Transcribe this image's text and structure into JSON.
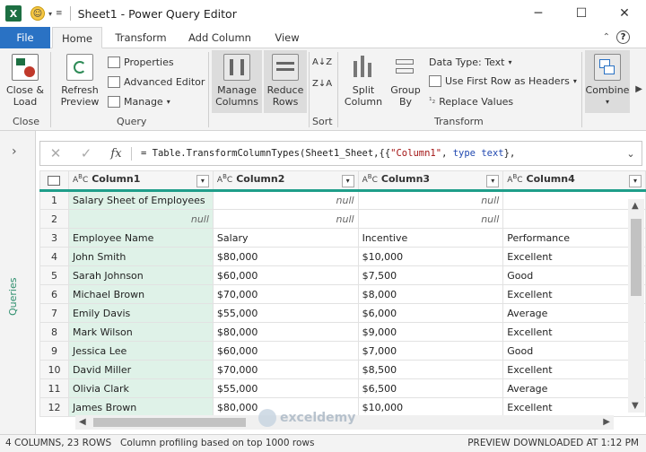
{
  "titlebar": {
    "logo": "X",
    "title": "Sheet1 - Power Query Editor",
    "minimize": "─",
    "maximize": "☐",
    "close": "✕"
  },
  "tabs": {
    "file": "File",
    "home": "Home",
    "transform": "Transform",
    "add_column": "Add Column",
    "view": "View",
    "help": "?"
  },
  "ribbon": {
    "close_load": "Close &\nLoad",
    "close_group": "Close",
    "refresh_preview": "Refresh\nPreview",
    "properties": "Properties",
    "advanced_editor": "Advanced Editor",
    "manage": "Manage",
    "query_group": "Query",
    "manage_columns": "Manage\nColumns",
    "reduce_rows": "Reduce\nRows",
    "sort_group": "Sort",
    "split_column": "Split\nColumn",
    "group_by": "Group\nBy",
    "data_type": "Data Type: Text",
    "use_first_row": "Use First Row as Headers",
    "replace_values": "Replace Values",
    "transform_group": "Transform",
    "combine": "Combine"
  },
  "sidebar": {
    "label": "Queries"
  },
  "formula": {
    "cancel": "✕",
    "commit": "✓",
    "fx": "fx",
    "prefix": "= Table.TransformColumnTypes(Sheet1_Sheet,{{",
    "string": "\"Column1\"",
    "sep": ", ",
    "keyword": "type text",
    "suffix": "},"
  },
  "table": {
    "columns": [
      "Column1",
      "Column2",
      "Column3",
      "Column4"
    ],
    "rows": [
      {
        "n": "1",
        "c": [
          "Salary Sheet of Employees",
          "null",
          "null",
          ""
        ]
      },
      {
        "n": "2",
        "c": [
          "null",
          "null",
          "null",
          ""
        ]
      },
      {
        "n": "3",
        "c": [
          "Employee Name",
          "Salary",
          "Incentive",
          "Performance"
        ]
      },
      {
        "n": "4",
        "c": [
          "John Smith",
          "$80,000",
          "$10,000",
          "Excellent"
        ]
      },
      {
        "n": "5",
        "c": [
          "Sarah Johnson",
          "$60,000",
          "$7,500",
          "Good"
        ]
      },
      {
        "n": "6",
        "c": [
          "Michael Brown",
          "$70,000",
          "$8,000",
          "Excellent"
        ]
      },
      {
        "n": "7",
        "c": [
          "Emily Davis",
          "$55,000",
          "$6,000",
          "Average"
        ]
      },
      {
        "n": "8",
        "c": [
          "Mark Wilson",
          "$80,000",
          "$9,000",
          "Excellent"
        ]
      },
      {
        "n": "9",
        "c": [
          "Jessica Lee",
          "$60,000",
          "$7,000",
          "Good"
        ]
      },
      {
        "n": "10",
        "c": [
          "David Miller",
          "$70,000",
          "$8,500",
          "Excellent"
        ]
      },
      {
        "n": "11",
        "c": [
          "Olivia Clark",
          "$55,000",
          "$6,500",
          "Average"
        ]
      },
      {
        "n": "12",
        "c": [
          "James Brown",
          "$80,000",
          "$10,000",
          "Excellent"
        ]
      }
    ]
  },
  "watermark": {
    "text": "exceldemy"
  },
  "status": {
    "left": "4 COLUMNS, 23 ROWS",
    "mid": "Column profiling based on top 1000 rows",
    "right": "PREVIEW DOWNLOADED AT 1:12 PM"
  },
  "colors": {
    "accent": "#2a72c4",
    "header_underline": "#1f9e8a",
    "selected_column": "#dff2e8",
    "excel_green": "#1d6f42"
  }
}
